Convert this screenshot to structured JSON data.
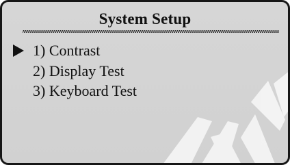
{
  "screen": {
    "title": "System Setup",
    "menu_items": [
      {
        "label": "1) Contrast",
        "selected": true
      },
      {
        "label": "2) Display Test",
        "selected": false
      },
      {
        "label": "3) Keyboard Test",
        "selected": false
      }
    ],
    "selector_icon": "right-pointing-triangle",
    "colors": {
      "background": "#d3d3d3",
      "text": "#111111",
      "border": "#161616"
    }
  }
}
